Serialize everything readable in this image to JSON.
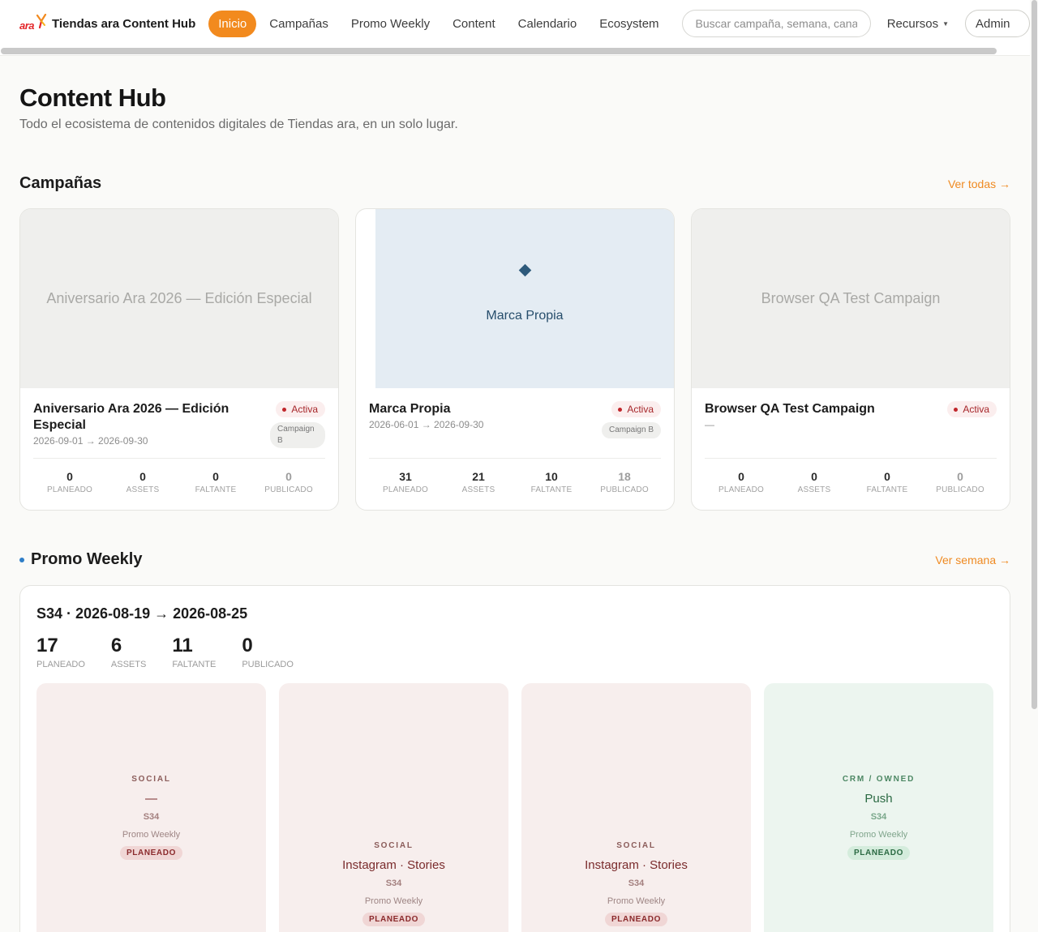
{
  "brand": {
    "logo_text": "ara",
    "name": "Tiendas ara Content Hub"
  },
  "nav": {
    "items": [
      {
        "label": "Inicio",
        "active": true
      },
      {
        "label": "Campañas",
        "active": false
      },
      {
        "label": "Promo Weekly",
        "active": false
      },
      {
        "label": "Content",
        "active": false
      },
      {
        "label": "Calendario",
        "active": false
      },
      {
        "label": "Ecosystem",
        "active": false
      }
    ],
    "search_placeholder": "Buscar campaña, semana, canal, tag…",
    "resources_label": "Recursos",
    "admin_label": "Admin"
  },
  "colors": {
    "accent": "#f28a1e",
    "active_badge": "#c0262b",
    "weekly_dot": "#2f7ec8"
  },
  "page": {
    "title": "Content Hub",
    "subtitle": "Todo el ecosistema de contenidos digitales de Tiendas ara, en un solo lugar."
  },
  "campaigns": {
    "title": "Campañas",
    "link": "Ver todas →",
    "cards": [
      {
        "cover_text": "Aniversario Ara 2026 — Edición Especial",
        "title": "Aniversario Ara 2026 — Edición Especial",
        "dates": "2026-09-01 → 2026-09-30",
        "status": "Activa",
        "tag": "Campaign B",
        "stats": [
          {
            "value": "0",
            "label": "PLANEADO"
          },
          {
            "value": "0",
            "label": "ASSETS"
          },
          {
            "value": "0",
            "label": "FALTANTE"
          },
          {
            "value": "0",
            "label": "PUBLICADO"
          }
        ]
      },
      {
        "cover_icon": "diamond-icon",
        "cover_text": "Marca Propia",
        "title": "Marca Propia",
        "dates": "2026-06-01 → 2026-09-30",
        "status": "Activa",
        "tag": "Campaign B",
        "stats": [
          {
            "value": "31",
            "label": "PLANEADO"
          },
          {
            "value": "21",
            "label": "ASSETS"
          },
          {
            "value": "10",
            "label": "FALTANTE"
          },
          {
            "value": "18",
            "label": "PUBLICADO"
          }
        ]
      },
      {
        "cover_text": "Browser QA Test Campaign",
        "title": "Browser QA Test Campaign",
        "dates": "—",
        "status": "Activa",
        "stats": [
          {
            "value": "0",
            "label": "PLANEADO"
          },
          {
            "value": "0",
            "label": "ASSETS"
          },
          {
            "value": "0",
            "label": "FALTANTE"
          },
          {
            "value": "0",
            "label": "PUBLICADO"
          }
        ]
      }
    ]
  },
  "weekly": {
    "title": "Promo Weekly",
    "link": "Ver semana →",
    "week_title": "S34 · 2026-08-19 → 2026-08-25",
    "stats": [
      {
        "value": "17",
        "label": "PLANEADO"
      },
      {
        "value": "6",
        "label": "ASSETS"
      },
      {
        "value": "11",
        "label": "FALTANTE"
      },
      {
        "value": "0",
        "label": "PUBLICADO"
      }
    ],
    "tiles": [
      {
        "channel": "SOCIAL",
        "name": "—",
        "week": "S34",
        "source": "Promo Weekly",
        "status": "PLANEADO"
      },
      {
        "channel": "SOCIAL",
        "name": "Instagram · Stories",
        "week": "S34",
        "source": "Promo Weekly",
        "status": "PLANEADO"
      },
      {
        "channel": "SOCIAL",
        "name": "Instagram · Stories",
        "week": "S34",
        "source": "Promo Weekly",
        "status": "PLANEADO"
      },
      {
        "channel": "CRM / OWNED",
        "name": "Push",
        "week": "S34",
        "source": "Promo Weekly",
        "status": "PLANEADO"
      }
    ]
  }
}
